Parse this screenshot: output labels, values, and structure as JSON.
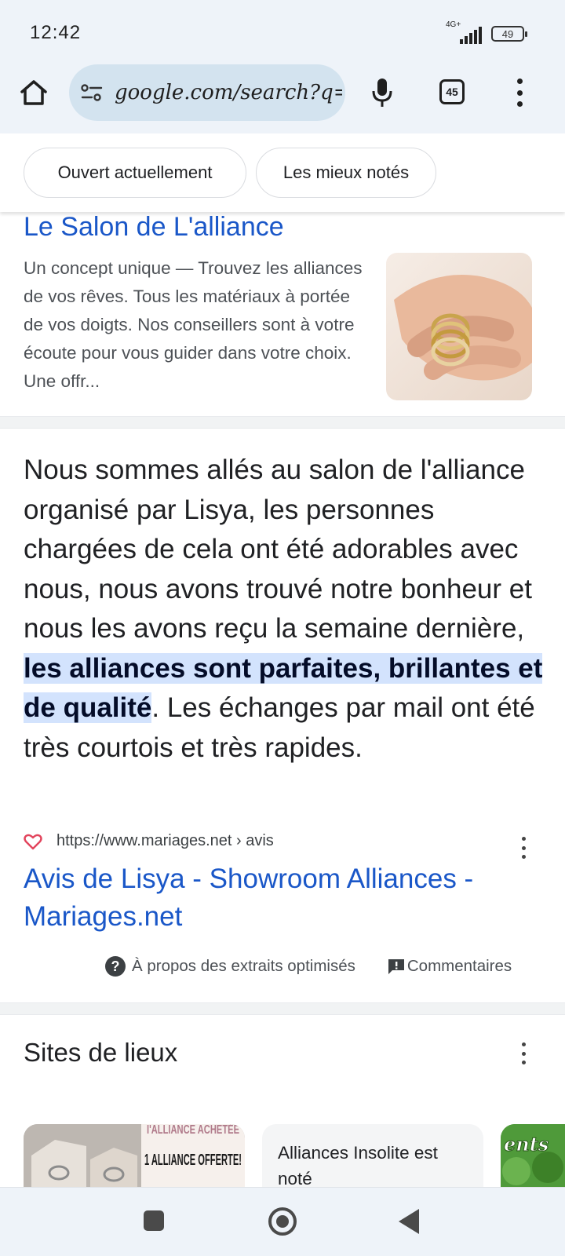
{
  "status": {
    "time": "12:42",
    "network": "4G+",
    "battery": "49"
  },
  "browser": {
    "url": "google.com/search?q=",
    "tab_count": "45"
  },
  "chips": [
    "Ouvert actuellement",
    "Les mieux notés"
  ],
  "result1": {
    "title": "Le Salon de L'alliance",
    "snippet": "Un concept unique — Trouvez les alliances de vos rêves. Tous les matériaux à portée de vos doigts. Nos conseillers sont à votre écoute pour vous guider dans votre choix. Une offr..."
  },
  "featured": {
    "text_before": "Nous sommes allés au salon de l'alliance organisé par Lisya, les personnes chargées de cela ont été adorables avec nous, nous avons trouvé notre bonheur et nous les avons reçu la semaine dernière, ",
    "highlight": "les alliances sont parfaites, brillantes et de qualité",
    "text_after": ". Les échanges par mail ont été très courtois et très rapides.",
    "source_url": "https://www.mariages.net › avis",
    "link_title": "Avis de Lisya - Showroom Alliances - Mariages.net",
    "about": "À propos des extraits optimisés",
    "feedback": "Commentaires"
  },
  "sites": {
    "title": "Sites de lieux",
    "card1_banner_top": "I'ALLIANCE ACHETÉE",
    "card1_banner": "1 ALLIANCE OFFERTE!",
    "card2_text": "Alliances Insolite est noté",
    "card3_text": "ents"
  }
}
